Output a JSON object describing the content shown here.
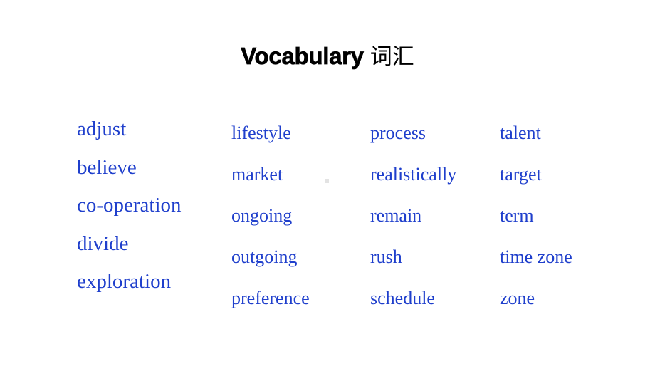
{
  "slide": {
    "background_color": "#ffffff",
    "word_color": "#1f3fcc",
    "title_color": "#000000"
  },
  "title": {
    "english": "Vocabulary",
    "chinese": "词汇"
  },
  "columns": [
    {
      "name": "column-1",
      "words": [
        "adjust",
        "believe",
        "co-operation",
        "divide",
        "exploration"
      ]
    },
    {
      "name": "column-2",
      "words": [
        "lifestyle",
        "market",
        "ongoing",
        "outgoing",
        "preference"
      ]
    },
    {
      "name": "column-3",
      "words": [
        "process",
        "realistically",
        "remain",
        "rush",
        "schedule"
      ]
    },
    {
      "name": "column-4",
      "words": [
        "talent",
        "target",
        "term",
        "time zone",
        "zone"
      ]
    }
  ]
}
